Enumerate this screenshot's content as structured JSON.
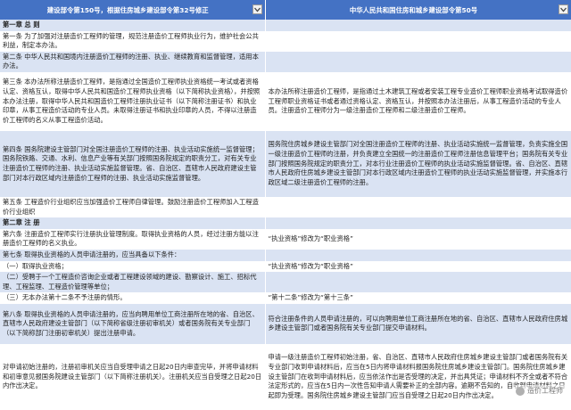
{
  "header": {
    "left": "建设部令第150号，根据住房城乡建设部令第32号修正",
    "right": "中华人民共和国住房和城乡建设部令第50号"
  },
  "rows": [
    {
      "left": "第一章 总 则",
      "right": "",
      "style": "chap"
    },
    {
      "left": "第一条 为了加强对注册造价工程师的管理，规范注册造价工程师执业行为，维护社会公共利益，制定本办法。",
      "right": "",
      "style": "light"
    },
    {
      "left": "第二条 中华人民共和国境内注册造价工程师的注册、执业、继续教育和监督管理，适用本办法。",
      "right": "",
      "style": "blue"
    },
    {
      "left": "第三条 本办法所称注册造价工程师，是指通过全国造价工程师执业资格统一考试或者资格认定、资格互认，取得中华人民共和国造价工程师执业资格（以下简称执业资格），并按照本办法注册，取得中华人民共和国造价工程师注册执业证书（以下简称注册证书）和执业印章，从事工程造价活动的专业人员。未取得注册证书和执业印章的人员，不得以注册造价工程师的名义从事工程造价活动。",
      "right": "本办法所称注册造价工程师，是指通过土木建筑工程或者安装工程专业造价工程师职业资格考试取得造价工程师职业资格证书或者通过资格认定、资格互认，并按照本办法注册后，从事工程造价活动的专业人员。注册造价工程师分为一级注册造价工程师和二级注册造价工程师。",
      "style": "light"
    },
    {
      "left": "第四条 国务院建设主管部门对全国注册造价工程师的注册、执业活动实施统一监督管理；国务院铁路、交通、水利、信息产业等有关部门按照国务院规定的职责分工，对有关专业注册造价工程师的注册、执业活动实施监督管理。省、自治区、直辖市人民政府建设主管部门对本行政区域内注册造价工程师的注册、执业活动实施监督管理。",
      "right": "国务院住房城乡建设主管部门对全国注册造价工程师的注册、执业活动实施统一监督管理，负责实施全国一级注册造价工程师的注册，并负责建立全国统一的注册造价工程师注册信息管理平台；国务院有关专业部门按照国务院规定的职责分工，对本行业注册造价工程师的执业活动实施监督管理。省、自治区、直辖市人民政府住房城乡建设主管部门对本行政区域内注册造价工程师的执业活动实施监督管理，并实施本行政区域二级注册造价工程师的注册。",
      "style": "blue"
    },
    {
      "left": "第五条 工程造价行业组织应当加强造价工程师自律管理。鼓励注册造价工程师加入工程造价行业组织",
      "right": "",
      "style": "light"
    },
    {
      "left": "第二章 注 册",
      "right": "",
      "style": "chap"
    },
    {
      "left": "第六条 注册造价工程师实行注册执业管理制度。取得执业资格的人员，经过注册方能以注册造价工程师的名义执业。",
      "right": "“执业资格”修改为“职业资格”",
      "style": "light"
    },
    {
      "left": "第七条 取得执业资格的人员申请注册的，应当具备以下条件：",
      "right": "",
      "style": "blue"
    },
    {
      "left": "（一）取得执业资格；",
      "right": "“执业资格”修改为“职业资格”",
      "style": "light"
    },
    {
      "left": "（二）受聘于一个工程造价咨询企业或者工程建设领域的建设、勘察设计、施工、招标代理、工程监理、工程造价管理等单位；",
      "right": "",
      "style": "blue"
    },
    {
      "left": "（三）无本办法第十二条不予注册的情形。",
      "right": "“第十二条”修改为“第十三条”",
      "style": "light"
    },
    {
      "left": "第八条 取得执业资格的人员申请注册的，应当向聘用单位工商注册所在地的省、自治区、直辖市人民政府建设主管部门（以下简称省级注册初审机关）或者国务院有关专业部门（以下简称部门注册初审机关）提出注册申请。",
      "right": "符合注册条件的人员申请注册的，可以向聘用单位工商注册所在地的省、自治区、直辖市人民政府住房城乡建设主管部门或者国务院有关专业部门提交申请材料。",
      "style": "blue"
    },
    {
      "left": "对申请初始注册的，注册初审机关应当自受理申请之日起20日内审查完毕，并将申请材料和初审意见报国务院建设主管部门（以下简称注册机关）。注册机关应当自受理之日起20日内作出决定。",
      "right": "申请一级注册造价工程师初始注册，省、自治区、直辖市人民政府住房城乡建设主管部门或者国务院有关专业部门收到申请材料后，应当在5日内将申请材料报国务院住房城乡建设主管部门。国务院住房城乡建设主管部门在收到申请材料后，应当依法作出是否受理的决定，并出具凭证；申请材料不齐全或者不符合法定形式的，应当在5日内一次性告知申请人需要补正的全部内容。逾期不告知的，自收到申请材料之日起即为受理。国务院住房城乡建设主管部门应当自受理之日起20日内作出决定。",
      "style": "light"
    }
  ],
  "watermark": {
    "text": "造价工程师",
    "icon": "wechat-icon"
  },
  "colors": {
    "header_bg": "#4472c4",
    "row_blue": "#dae3f3",
    "row_light": "#ffffff"
  }
}
